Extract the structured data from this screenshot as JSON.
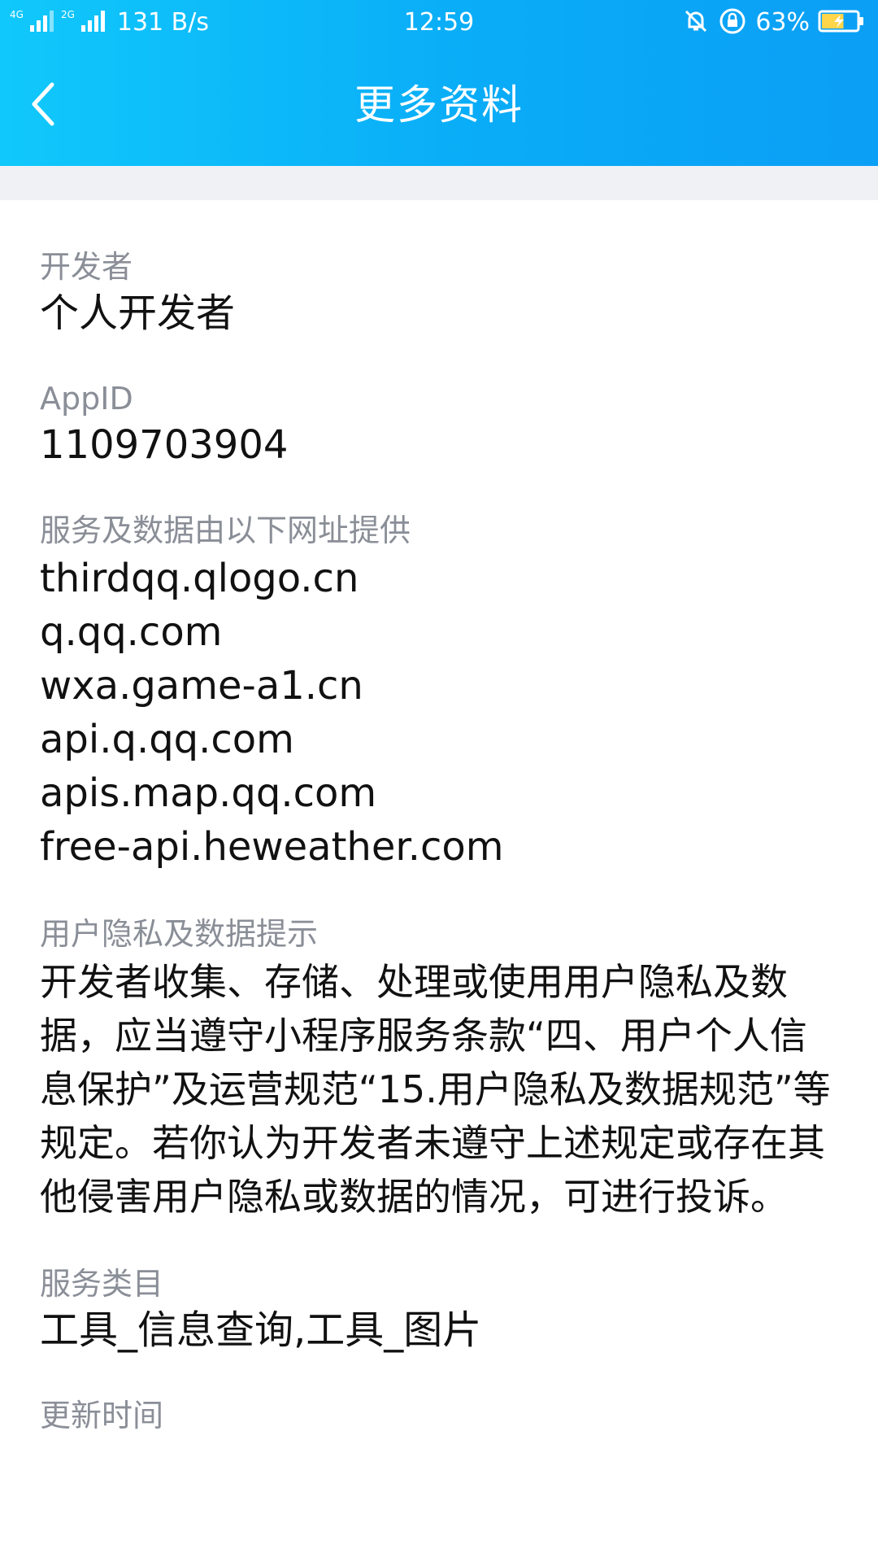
{
  "status_bar": {
    "volte": "4G",
    "net_4g": "4G",
    "net_2g": "2G",
    "net_speed": "131 B/s",
    "time": "12:59",
    "battery_pct": "63%",
    "battery_level": 0.63
  },
  "nav": {
    "title": "更多资料"
  },
  "sections": {
    "developer": {
      "label": "开发者",
      "value": "个人开发者"
    },
    "appid": {
      "label": "AppID",
      "value": "1109703904"
    },
    "domains": {
      "label": "服务及数据由以下网址提供",
      "items": [
        "thirdqq.qlogo.cn",
        "q.qq.com",
        "wxa.game-a1.cn",
        "api.q.qq.com",
        "apis.map.qq.com",
        "free-api.heweather.com"
      ]
    },
    "privacy": {
      "label": "用户隐私及数据提示",
      "text": "开发者收集、存储、处理或使用用户隐私及数据，应当遵守小程序服务条款“四、用户个人信息保护”及运营规范“15.用户隐私及数据规范”等规定。若你认为开发者未遵守上述规定或存在其他侵害用户隐私或数据的情况，可进行投诉。"
    },
    "category": {
      "label": "服务类目",
      "value": "工具_信息查询,工具_图片"
    },
    "update_time": {
      "label": "更新时间"
    }
  },
  "colors": {
    "header_gradient_start": "#10c8fb",
    "header_gradient_end": "#0b9ff6",
    "label": "#8a8e97",
    "value": "#111111",
    "gap_strip": "#f0f1f5"
  }
}
